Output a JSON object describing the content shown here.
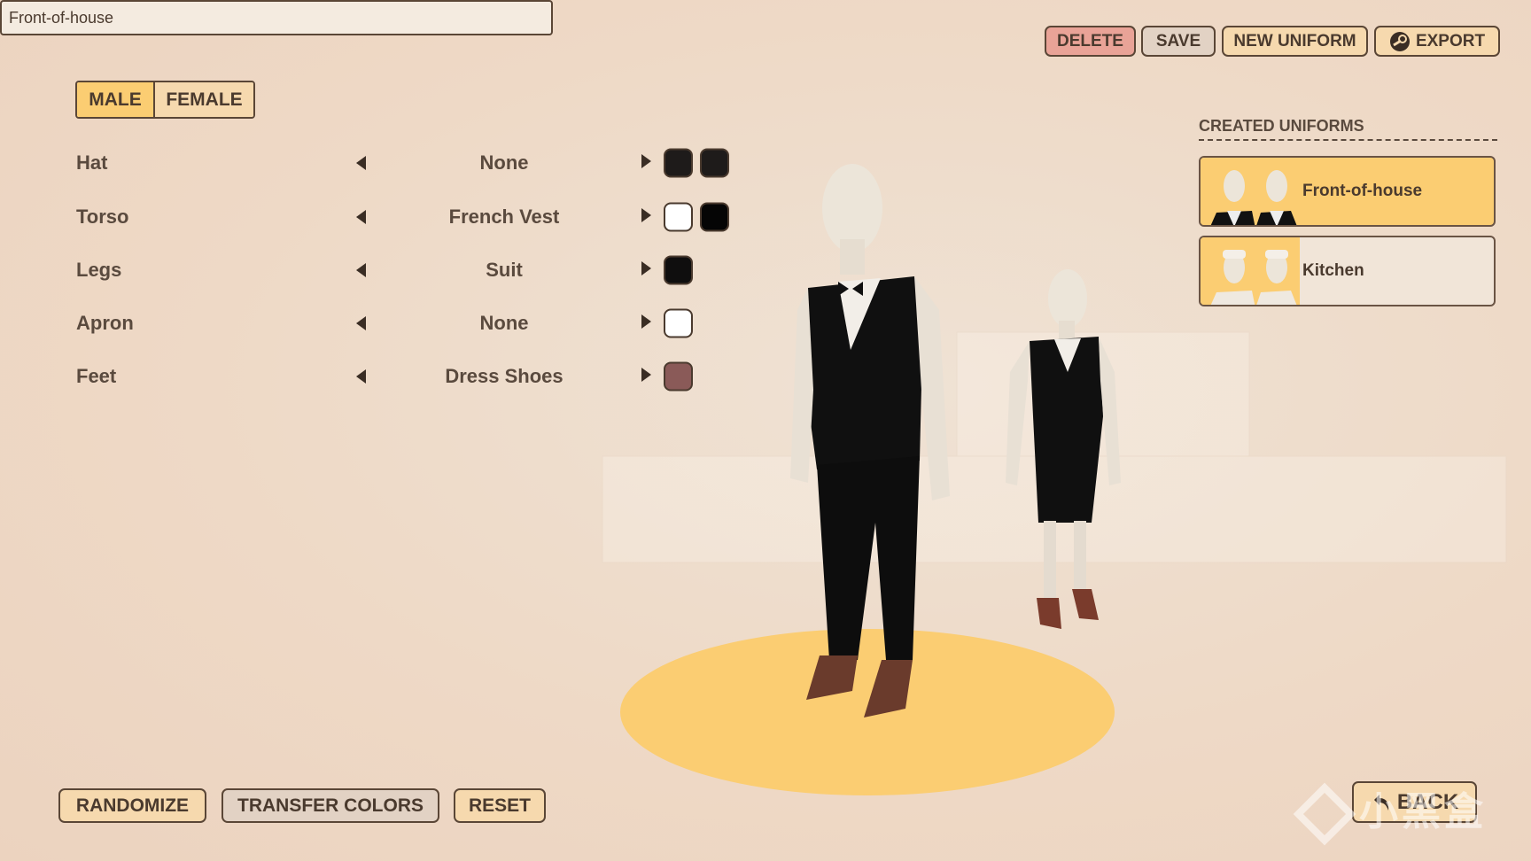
{
  "uniform_name": {
    "value": "Front-of-house"
  },
  "gender": {
    "options": [
      "MALE",
      "FEMALE"
    ],
    "selected": "MALE"
  },
  "slots": [
    {
      "label": "Hat",
      "value": "None",
      "colors": [
        "#1e1b1a",
        "#1e1b1a"
      ]
    },
    {
      "label": "Torso",
      "value": "French Vest",
      "colors": [
        "#ffffff",
        "#050505"
      ]
    },
    {
      "label": "Legs",
      "value": "Suit",
      "colors": [
        "#0f0e0e"
      ]
    },
    {
      "label": "Apron",
      "value": "None",
      "colors": [
        "#ffffff"
      ]
    },
    {
      "label": "Feet",
      "value": "Dress Shoes",
      "colors": [
        "#8a5a58"
      ]
    }
  ],
  "toolbar": {
    "delete": "DELETE",
    "save": "SAVE",
    "new_uniform": "NEW UNIFORM",
    "export": "EXPORT",
    "export_icon": "steam-icon"
  },
  "created_uniforms": {
    "title": "CREATED UNIFORMS",
    "items": [
      {
        "name": "Front-of-house",
        "selected": true
      },
      {
        "name": "Kitchen",
        "selected": false
      }
    ]
  },
  "bottom": {
    "randomize": "RANDOMIZE",
    "transfer_colors": "TRANSFER COLORS",
    "reset": "RESET",
    "back": "BACK",
    "back_icon": "undo-arrow-icon"
  },
  "watermark": "小黑盒",
  "colors": {
    "accent": "#fbcd72",
    "button": "#f6d9ae",
    "delete": "#e9a397",
    "save": "#e2d2c4",
    "border": "#5a4636"
  }
}
